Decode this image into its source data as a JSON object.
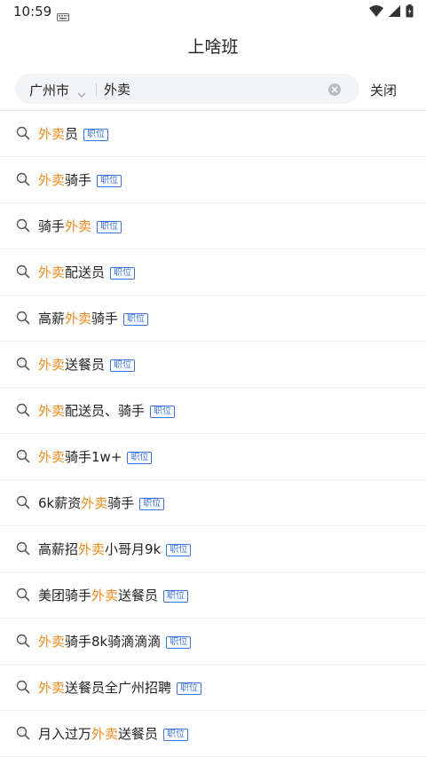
{
  "status_bar": {
    "time": "10:59"
  },
  "header": {
    "title": "上啥班"
  },
  "search": {
    "city": "广州市",
    "value": "外卖",
    "close_label": "关闭"
  },
  "suggestions": [
    {
      "pre": "",
      "hl": "外卖",
      "post": "员",
      "tag": "职位"
    },
    {
      "pre": "",
      "hl": "外卖",
      "post": "骑手",
      "tag": "职位"
    },
    {
      "pre": "骑手",
      "hl": "外卖",
      "post": "",
      "tag": "职位"
    },
    {
      "pre": "",
      "hl": "外卖",
      "post": "配送员",
      "tag": "职位"
    },
    {
      "pre": "高薪",
      "hl": "外卖",
      "post": "骑手",
      "tag": "职位"
    },
    {
      "pre": "",
      "hl": "外卖",
      "post": "送餐员",
      "tag": "职位"
    },
    {
      "pre": "",
      "hl": "外卖",
      "post": "配送员、骑手",
      "tag": "职位"
    },
    {
      "pre": "",
      "hl": "外卖",
      "post": "骑手1w+",
      "tag": "职位"
    },
    {
      "pre": "6k薪资",
      "hl": "外卖",
      "post": "骑手",
      "tag": "职位"
    },
    {
      "pre": "高薪招",
      "hl": "外卖",
      "post": "小哥月9k",
      "tag": "职位"
    },
    {
      "pre": "美团骑手",
      "hl": "外卖",
      "post": "送餐员",
      "tag": "职位"
    },
    {
      "pre": "",
      "hl": "外卖",
      "post": "骑手8k骑滴滴滴",
      "tag": "职位"
    },
    {
      "pre": "",
      "hl": "外卖",
      "post": "送餐员全广州招聘",
      "tag": "职位"
    },
    {
      "pre": "月入过万",
      "hl": "外卖",
      "post": "送餐员",
      "tag": "职位"
    }
  ],
  "colors": {
    "highlight": "#f08a1a",
    "tag": "#3a73e8"
  }
}
